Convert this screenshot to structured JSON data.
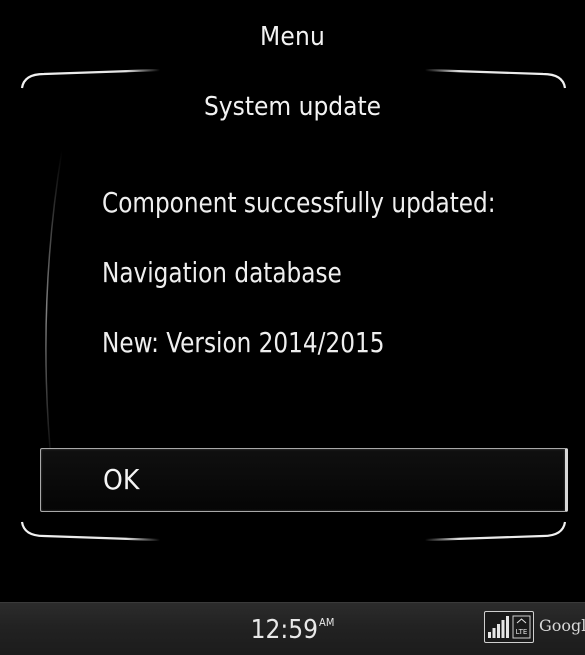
{
  "header": {
    "menu_title": "Menu",
    "section_title": "System update"
  },
  "message": {
    "line1": "Component successfully updated:",
    "line2": "Navigation database",
    "line3": "New: Version 2014/2015"
  },
  "actions": {
    "ok_label": "OK"
  },
  "status_bar": {
    "time": "12:59",
    "ampm": "AM",
    "network": "LTE",
    "brand": "Google"
  },
  "icons": {
    "signal": "signal-strength-icon",
    "network": "lte-icon"
  }
}
